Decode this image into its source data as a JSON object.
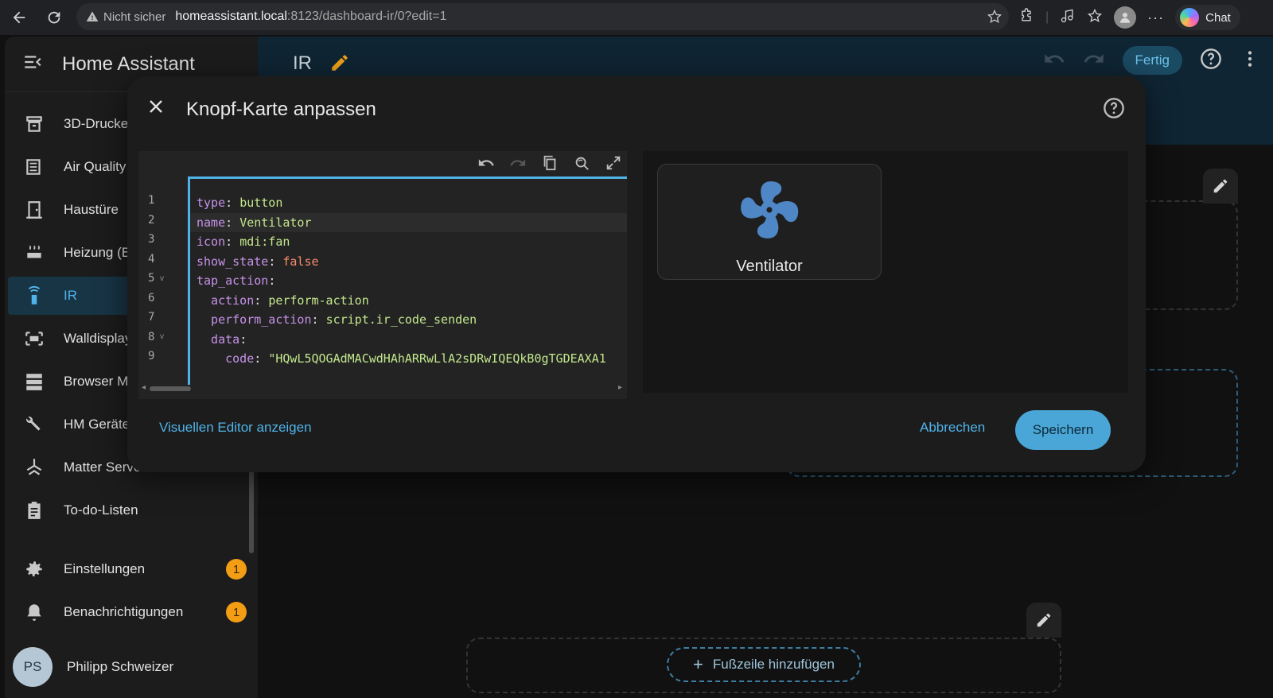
{
  "browser": {
    "security_label": "Nicht sicher",
    "url_host": "homeassistant.local",
    "url_path": ":8123/dashboard-ir/0?edit=1",
    "chat_label": "Chat"
  },
  "sidebar": {
    "title": "Home Assistant",
    "items": [
      {
        "label": "3D-Drucker",
        "icon": "printer-3d-icon"
      },
      {
        "label": "Air Quality",
        "icon": "air-filter-icon"
      },
      {
        "label": "Haustüre",
        "icon": "door-icon"
      },
      {
        "label": "Heizung (B",
        "icon": "radiator-icon"
      },
      {
        "label": "IR",
        "icon": "remote-icon",
        "active": true
      },
      {
        "label": "Walldisplay",
        "icon": "monitor-icon"
      },
      {
        "label": "Browser M",
        "icon": "server-icon"
      },
      {
        "label": "HM Geräte",
        "icon": "tools-icon"
      },
      {
        "label": "Matter Server",
        "icon": "matter-icon"
      },
      {
        "label": "To-do-Listen",
        "icon": "clipboard-list-icon"
      },
      {
        "label": "Einstellungen",
        "icon": "cog-icon",
        "badge": "1"
      },
      {
        "label": "Benachrichtigungen",
        "icon": "bell-icon",
        "badge": "1"
      }
    ],
    "user": {
      "initials": "PS",
      "name": "Philipp Schweizer"
    }
  },
  "topbar": {
    "title": "IR",
    "done_label": "Fertig"
  },
  "dialog": {
    "title": "Knopf-Karte anpassen",
    "code_lines": [
      {
        "n": "1",
        "key": "type",
        "sep": ": ",
        "val": "button",
        "type": "v"
      },
      {
        "n": "2",
        "key": "name",
        "sep": ": ",
        "val": "Ventilator",
        "type": "v"
      },
      {
        "n": "3",
        "key": "icon",
        "sep": ": ",
        "val": "mdi:fan",
        "type": "v"
      },
      {
        "n": "4",
        "key": "show_state",
        "sep": ": ",
        "val": "false",
        "type": "b"
      },
      {
        "n": "5",
        "key": "tap_action",
        "sep": ":",
        "val": "",
        "type": "v"
      },
      {
        "n": "6",
        "key": "  action",
        "sep": ": ",
        "val": "perform-action",
        "type": "v"
      },
      {
        "n": "7",
        "key": "  perform_action",
        "sep": ": ",
        "val": "script.ir_code_senden",
        "type": "v"
      },
      {
        "n": "8",
        "key": "  data",
        "sep": ":",
        "val": "",
        "type": "v"
      },
      {
        "n": "9",
        "key": "    code",
        "sep": ": ",
        "val": "\"HQwL5QOGAdMACwdHAhARRwLlA2sDRwIQEQkB0gTGDEAXA1",
        "type": "v"
      }
    ],
    "preview_name": "Ventilator",
    "visual_editor_label": "Visuellen Editor anzeigen",
    "cancel_label": "Abbrechen",
    "save_label": "Speichern"
  },
  "footer_add_label": "Fußzeile hinzufügen",
  "colors": {
    "accent": "#4fb3e8",
    "badge": "#f29d13",
    "fan_icon": "#4f86c6",
    "pencil": "#f2a219"
  }
}
